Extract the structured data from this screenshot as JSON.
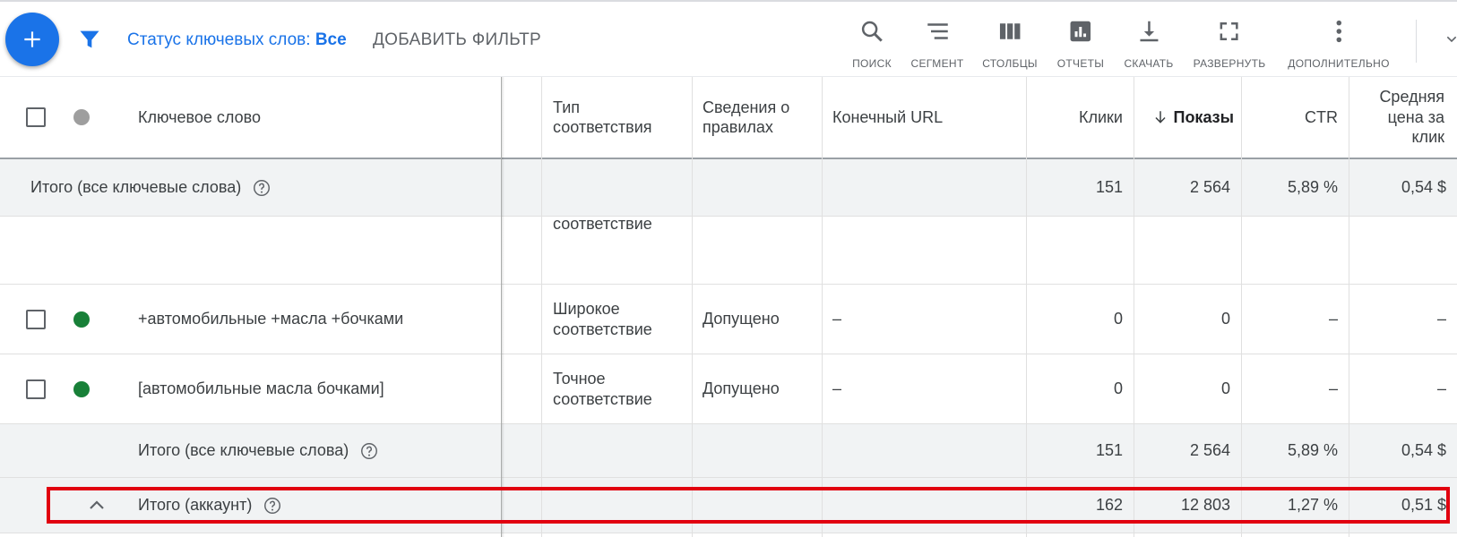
{
  "toolbar": {
    "filter_status_label": "Статус ключевых слов:",
    "filter_status_value": "Все",
    "add_filter": "ДОБАВИТЬ ФИЛЬТР",
    "tools": [
      {
        "label": "ПОИСК",
        "icon": "search-icon"
      },
      {
        "label": "СЕГМЕНТ",
        "icon": "segment-icon"
      },
      {
        "label": "СТОЛБЦЫ",
        "icon": "columns-icon"
      },
      {
        "label": "ОТЧЕТЫ",
        "icon": "reports-icon"
      },
      {
        "label": "СКАЧАТЬ",
        "icon": "download-icon"
      },
      {
        "label": "РАЗВЕРНУТЬ",
        "icon": "fullscreen-icon"
      },
      {
        "label": "ДОПОЛНИТЕЛЬНО",
        "icon": "more-vert-icon"
      }
    ]
  },
  "columns": {
    "keyword": "Ключевое слово",
    "match_type_1": "Тип",
    "match_type_2": "соответствия",
    "policy_1": "Сведения о",
    "policy_2": "правилах",
    "final_url": "Конечный URL",
    "clicks": "Клики",
    "impressions": "Показы",
    "ctr": "CTR",
    "cpc_1": "Средняя",
    "cpc_2": "цена за",
    "cpc_3": "клик"
  },
  "top_total": {
    "label": "Итого (все ключевые слова)",
    "clicks": "151",
    "impressions": "2 564",
    "ctr": "5,89 %",
    "cpc": "0,54 $"
  },
  "partial_row": {
    "match_type": "соответствие"
  },
  "rows": [
    {
      "keyword": "+автомобильные +масла +бочками",
      "match_type_1": "Широкое",
      "match_type_2": "соответствие",
      "policy": "Допущено",
      "final_url": "–",
      "clicks": "0",
      "impressions": "0",
      "ctr": "–",
      "cpc": "–"
    },
    {
      "keyword": "[автомобильные масла бочками]",
      "match_type_1": "Точное",
      "match_type_2": "соответствие",
      "policy": "Допущено",
      "final_url": "–",
      "clicks": "0",
      "impressions": "0",
      "ctr": "–",
      "cpc": "–"
    }
  ],
  "bottom_total": {
    "label": "Итого (все ключевые слова)",
    "clicks": "151",
    "impressions": "2 564",
    "ctr": "5,89 %",
    "cpc": "0,54 $"
  },
  "account_total": {
    "label": "Итого (аккаунт)",
    "clicks": "162",
    "impressions": "12 803",
    "ctr": "1,27 %",
    "cpc": "0,51 $"
  },
  "colors": {
    "accent": "#1a73e8",
    "status_enabled": "#188038",
    "status_header": "#9e9e9e",
    "highlight": "#e1000f"
  }
}
